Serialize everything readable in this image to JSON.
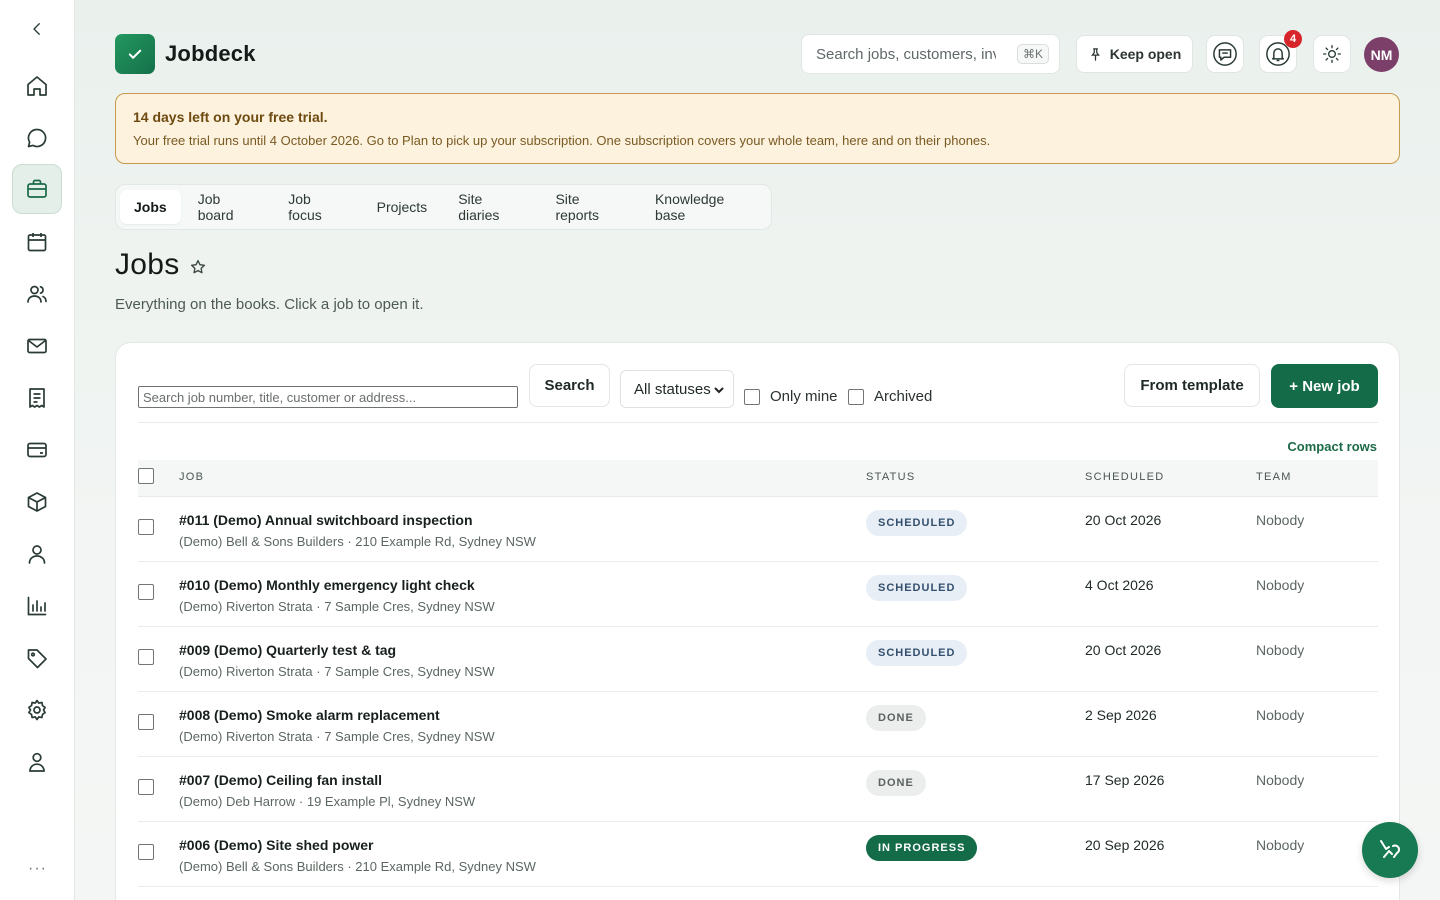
{
  "app": {
    "name": "Jobdeck"
  },
  "header": {
    "search_placeholder": "Search jobs, customers, invoices",
    "shortcut": "⌘K",
    "keep_open_label": "Keep open",
    "notification_count": "4",
    "avatar_initials": "NM"
  },
  "trial": {
    "title": "14 days left on your free trial.",
    "body": "Your free trial runs until 4 October 2026. Go to Plan to pick up your subscription. One subscription covers your whole team, here and on their phones."
  },
  "tabs": [
    {
      "label": "Jobs",
      "active": true
    },
    {
      "label": "Job board"
    },
    {
      "label": "Job focus"
    },
    {
      "label": "Projects"
    },
    {
      "label": "Site diaries"
    },
    {
      "label": "Site reports"
    },
    {
      "label": "Knowledge base"
    }
  ],
  "page": {
    "title": "Jobs",
    "subtitle": "Everything on the books. Click a job to open it."
  },
  "toolbar": {
    "search_placeholder": "Search job number, title, customer or address...",
    "search_label": "Search",
    "status_filter": "All statuses",
    "only_mine_label": "Only mine",
    "archived_label": "Archived",
    "from_template_label": "From template",
    "new_job_label": "+ New job",
    "compact_rows_label": "Compact rows"
  },
  "table": {
    "columns": {
      "job": "JOB",
      "status": "STATUS",
      "scheduled": "SCHEDULED",
      "team": "TEAM"
    },
    "rows": [
      {
        "title": "#011 (Demo) Annual switchboard inspection",
        "sub": "(Demo) Bell & Sons Builders · 210 Example Rd, Sydney NSW",
        "status": "SCHEDULED",
        "status_kind": "scheduled",
        "scheduled": "20 Oct 2026",
        "team": "Nobody"
      },
      {
        "title": "#010 (Demo) Monthly emergency light check",
        "sub": "(Demo) Riverton Strata · 7 Sample Cres, Sydney NSW",
        "status": "SCHEDULED",
        "status_kind": "scheduled",
        "scheduled": "4 Oct 2026",
        "team": "Nobody"
      },
      {
        "title": "#009 (Demo) Quarterly test & tag",
        "sub": "(Demo) Riverton Strata · 7 Sample Cres, Sydney NSW",
        "status": "SCHEDULED",
        "status_kind": "scheduled",
        "scheduled": "20 Oct 2026",
        "team": "Nobody"
      },
      {
        "title": "#008 (Demo) Smoke alarm replacement",
        "sub": "(Demo) Riverton Strata · 7 Sample Cres, Sydney NSW",
        "status": "DONE",
        "status_kind": "done",
        "scheduled": "2 Sep 2026",
        "team": "Nobody"
      },
      {
        "title": "#007 (Demo) Ceiling fan install",
        "sub": "(Demo) Deb Harrow · 19 Example Pl, Sydney NSW",
        "status": "DONE",
        "status_kind": "done",
        "scheduled": "17 Sep 2026",
        "team": "Nobody"
      },
      {
        "title": "#006 (Demo) Site shed power",
        "sub": "(Demo) Bell & Sons Builders · 210 Example Rd, Sydney NSW",
        "status": "IN PROGRESS",
        "status_kind": "inprogress",
        "scheduled": "20 Sep 2026",
        "team": "Nobody"
      }
    ]
  },
  "sidebar": {
    "items": [
      {
        "icon": "chevron-left-icon"
      },
      {
        "icon": "home-icon"
      },
      {
        "icon": "chat-icon"
      },
      {
        "icon": "briefcase-icon",
        "active": true
      },
      {
        "icon": "calendar-icon"
      },
      {
        "icon": "users-icon"
      },
      {
        "icon": "mail-icon"
      },
      {
        "icon": "receipt-icon"
      },
      {
        "icon": "credit-card-icon"
      },
      {
        "icon": "box-icon"
      },
      {
        "icon": "user-icon"
      },
      {
        "icon": "bar-chart-icon"
      },
      {
        "icon": "tag-icon"
      },
      {
        "icon": "gear-icon"
      },
      {
        "icon": "profile-icon"
      }
    ],
    "more": "···"
  },
  "colors": {
    "brand": "#136b48",
    "trial_bg": "#fcf2dd",
    "trial_border": "#c79a4e"
  }
}
